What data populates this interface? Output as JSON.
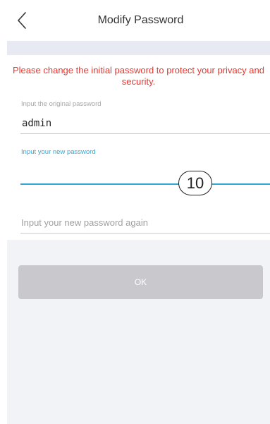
{
  "header": {
    "title": "Modify Password",
    "back_icon": "chevron-left-icon"
  },
  "form": {
    "warning": "Please change the initial password to protect your privacy and security.",
    "original_password": {
      "label": "Input the original password",
      "value": "admin"
    },
    "new_password": {
      "label": "Input your new password",
      "value": ""
    },
    "confirm_password": {
      "placeholder": "Input your new password again",
      "value": ""
    },
    "callout": "10"
  },
  "ok_button": {
    "label": "OK"
  },
  "colors": {
    "warning": "#e8372e",
    "accent": "#2ea9d6",
    "button_disabled": "#c9c9cd",
    "background": "#f2f3f7"
  }
}
